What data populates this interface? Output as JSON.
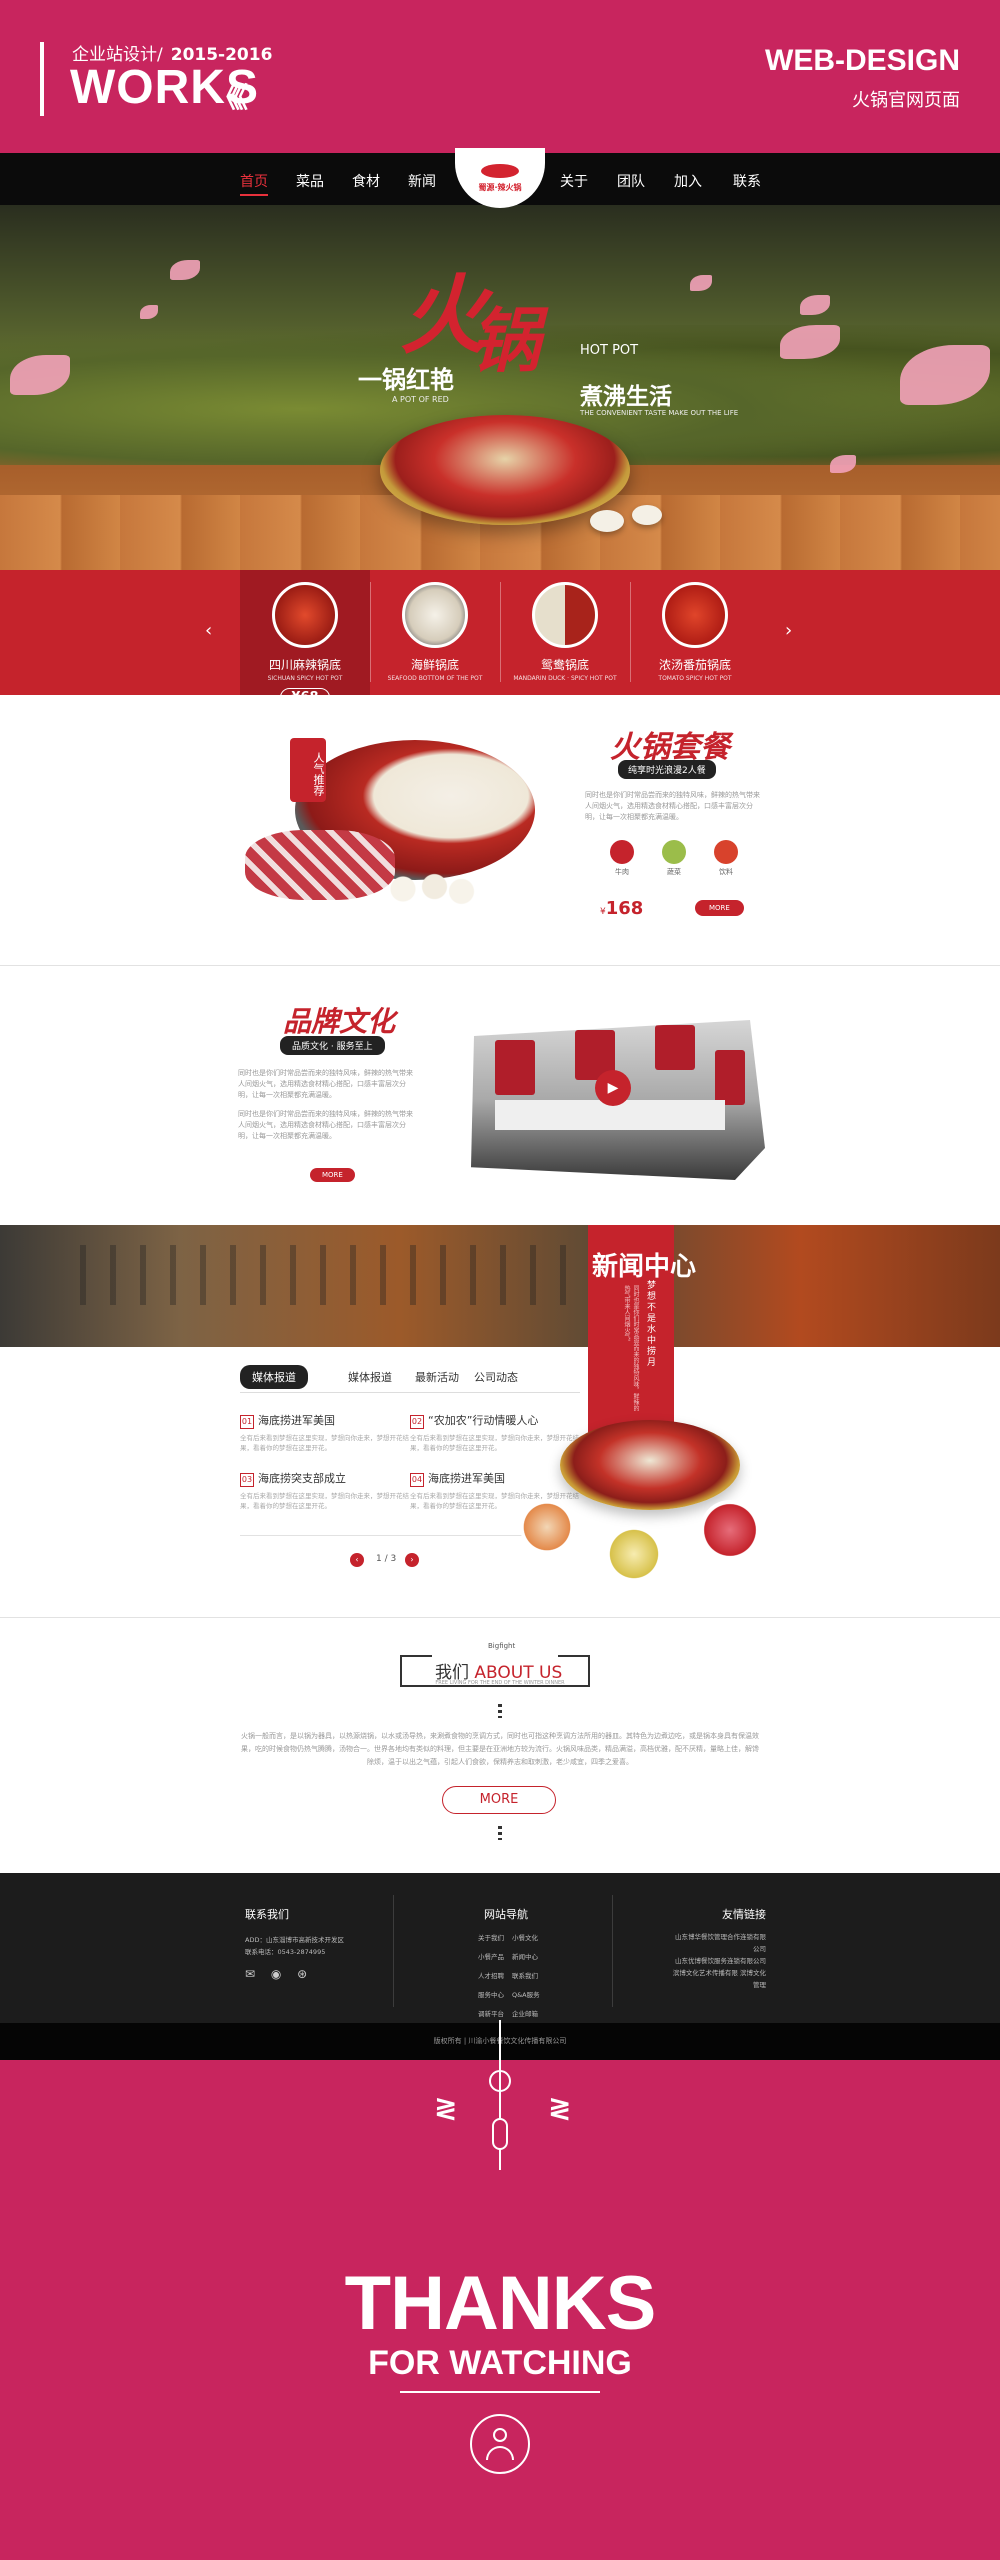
{
  "header": {
    "subtitle": "企业站设计/",
    "years": "2015-2016",
    "works": "WORKS",
    "works_deco": "《《",
    "design": "WEB-DESIGN",
    "project": "火锅官网页面"
  },
  "nav": {
    "items": [
      "首页",
      "菜品",
      "食材",
      "新闻",
      "关于",
      "团队",
      "加入",
      "联系"
    ],
    "logo_text": "蜀源·辣火锅"
  },
  "hero": {
    "char1": "火",
    "char2": "锅",
    "hotpot": "HOT POT",
    "line1": "一锅红艳",
    "potof": "A POT OF RED",
    "line2": "煮沸生活",
    "tagline": "THE CONVENIENT TASTE MAKE OUT THE LIFE"
  },
  "carousel": {
    "prev": "‹",
    "next": "›",
    "items": [
      {
        "name": "四川麻辣锅底",
        "en": "SICHUAN SPICY HOT POT",
        "price": "¥68"
      },
      {
        "name": "海鲜锅底",
        "en": "SEAFOOD BOTTOM OF THE POT",
        "price": ""
      },
      {
        "name": "鸳鸯锅底",
        "en": "MANDARIN DUCK · SPICY HOT POT",
        "price": ""
      },
      {
        "name": "浓汤番茄锅底",
        "en": "TOMATO SPICY HOT POT",
        "price": ""
      }
    ]
  },
  "set_meal": {
    "badge": "人气推荐",
    "title": "火锅套餐",
    "tag": "纯享时光浪漫2人餐",
    "desc": "同时也是你们时常品尝而来的独特风味，鲜辣的热气带来人间烟火气，选用精选食材精心搭配，口感丰富层次分明，让每一次相聚都充满温暖。",
    "icons": [
      {
        "label": "牛肉",
        "color": "#c5232c"
      },
      {
        "label": "蔬菜",
        "color": "#9bbd4a"
      },
      {
        "label": "饮料",
        "color": "#d8422c"
      }
    ],
    "price_prefix": "¥",
    "price": "168",
    "more": "MORE"
  },
  "brand": {
    "title": "品牌文化",
    "tag": "品质文化 · 服务至上",
    "para1": "同时也是你们时常品尝而来的独特风味，鲜辣的热气带来人间烟火气，选用精选食材精心搭配，口感丰富层次分明，让每一次相聚都充满温暖。",
    "para2": "同时也是你们时常品尝而来的独特风味，鲜辣的热气带来人间烟火气，选用精选食材精心搭配，口感丰富层次分明，让每一次相聚都充满温暖。",
    "more": "MORE",
    "play": "▶"
  },
  "news": {
    "title": "新闻中心",
    "vertical": "梦想不是水中捞月",
    "vertical_small": "同时也是你们时常品尝而来的独特风味，鲜辣的热气带来人间烟火气。",
    "tabs": [
      "媒体报道",
      "媒体报道",
      "最新活动",
      "公司动态"
    ],
    "items": [
      {
        "num": "01",
        "title": "海底捞进军美国",
        "desc": "全有后来看到梦想在这里实现，梦想向你走来，梦想开花结果，看着你的梦想在这里开花。"
      },
      {
        "num": "02",
        "title": "“农加农”行动情暖人心",
        "desc": "全有后来看到梦想在这里实现，梦想向你走来，梦想开花结果，看着你的梦想在这里开花。"
      },
      {
        "num": "03",
        "title": "海底捞突支部成立",
        "desc": "全有后来看到梦想在这里实现，梦想向你走来，梦想开花结果，看着你的梦想在这里开花。"
      },
      {
        "num": "04",
        "title": "海底捞进军美国",
        "desc": "全有后来看到梦想在这里实现，梦想向你走来，梦想开花结果，看着你的梦想在这里开花。"
      }
    ],
    "page": "1 / 3",
    "prev": "‹",
    "next": "›"
  },
  "about": {
    "small": "Bigfight",
    "title_cn": "我们",
    "title_en": "ABOUT US",
    "sub": "FREE LIVING FOR THE END OF THE WINTER DINNER",
    "text": "火锅一般而言，是以锅为器具，以热源烧锅，以水或汤导热，来涮煮食物的烹调方式，同时也可指这种烹调方法所用的器皿。其特色为边煮边吃，或是锅本身具有保温效果，吃的时候食物仍热气腾腾，汤物合一。世界各地均有类似的料理，但主要是在亚洲地方较为流行。火锅风味品类，精品满溢，高档优雅，配不厌精，量略上佳，解馋除烦，温于以出之气蕴，引起人们食欲，保精养志和取刺激，老少咸宜，四季之爱喜。",
    "more": "MORE"
  },
  "footer": {
    "contact_title": "联系我们",
    "address": "ADD：山东淄博市高新技术开发区",
    "phone": "联系电话：0543-2874995",
    "social": "✉ ◉ ⊛",
    "nav_title": "网站导航",
    "nav_col1": [
      "关于我们",
      "小餐产品",
      "人才招聘",
      "服务中心",
      "调新平台"
    ],
    "nav_col2": [
      "小餐文化",
      "新闻中心",
      "联系我们",
      "Q&A服务",
      "企业邮箱"
    ],
    "links_title": "友情链接",
    "links": [
      "山东博华餐饮管理合作连锁有限公司",
      "山东优博餐饮服务连锁有限公司",
      "滨博文化艺术传播有限  滨博文化管理"
    ],
    "copyright": "版权所有 | 川渝小餐餐饮文化传播有限公司"
  },
  "thanks": {
    "big": "THANKS",
    "small": "FOR WATCHING",
    "zig": "≷"
  }
}
